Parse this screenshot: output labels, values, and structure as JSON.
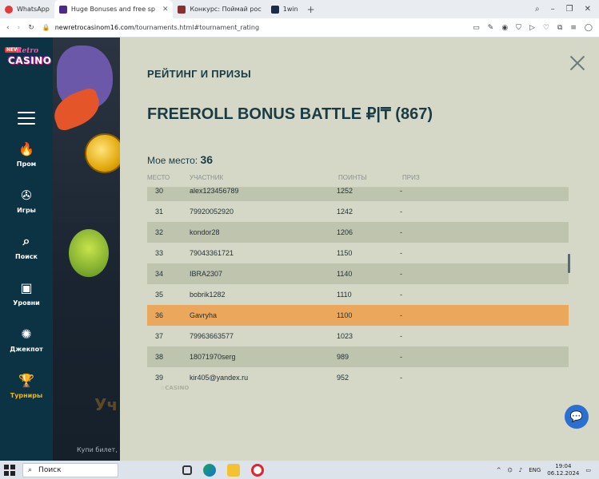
{
  "browser": {
    "tabs": [
      {
        "label": "WhatsApp",
        "fav_color": "#25d366",
        "active": false
      },
      {
        "label": "Huge Bonuses and free sp",
        "fav_color": "#4d2a8a",
        "active": true
      },
      {
        "label": "Конкурс: Поймай рос",
        "fav_color": "#8a2f2f",
        "active": false
      },
      {
        "label": "1win",
        "fav_color": "#1c2b49",
        "active": false
      }
    ],
    "url_host": "newretrocasinom16.com",
    "url_path": "/tournaments.html#tournament_rating"
  },
  "sidebar": {
    "logo_new": "NEW",
    "logo_retro": "Retro",
    "logo_casino": "CASINO",
    "items": [
      {
        "label": "Пром",
        "icon": "fire-icon"
      },
      {
        "label": "Игры",
        "icon": "chip-icon"
      },
      {
        "label": "Поиск",
        "icon": "search-icon"
      },
      {
        "label": "Уровни",
        "icon": "chest-icon"
      },
      {
        "label": "Джекпот",
        "icon": "jackpot-icon"
      },
      {
        "label": "Турниры",
        "icon": "trophy-icon"
      }
    ],
    "lang": "RU"
  },
  "background": {
    "footer_text": "Купи билет,",
    "big_letters": "Уч"
  },
  "modal": {
    "heading": "РЕЙТИНГ И ПРИЗЫ",
    "title": "FREEROLL BONUS BATTLE ₽|₸ (867)",
    "my_place_label": "Мое место:",
    "my_place_value": "36",
    "columns": [
      "МЕСТО",
      "УЧАСТНИК",
      "ПОИНТЫ",
      "ПРИЗ"
    ],
    "rows": [
      {
        "place": "30",
        "user": "alex123456789",
        "points": "1252",
        "prize": "-"
      },
      {
        "place": "31",
        "user": "79920052920",
        "points": "1242",
        "prize": "-"
      },
      {
        "place": "32",
        "user": "kondor28",
        "points": "1206",
        "prize": "-"
      },
      {
        "place": "33",
        "user": "79043361721",
        "points": "1150",
        "prize": "-"
      },
      {
        "place": "34",
        "user": "IBRA2307",
        "points": "1140",
        "prize": "-"
      },
      {
        "place": "35",
        "user": "bobrik1282",
        "points": "1110",
        "prize": "-"
      },
      {
        "place": "36",
        "user": "Gavryha",
        "points": "1100",
        "prize": "-"
      },
      {
        "place": "37",
        "user": "79963663577",
        "points": "1023",
        "prize": "-"
      },
      {
        "place": "38",
        "user": "18071970serg",
        "points": "989",
        "prize": "-"
      },
      {
        "place": "39",
        "user": "kir405@yandex.ru",
        "points": "952",
        "prize": "-"
      }
    ],
    "highlight_place": "36"
  },
  "taskbar": {
    "search_label": "Поиск",
    "lang": "ENG",
    "time": "19:04",
    "date": "06.12.2024"
  }
}
